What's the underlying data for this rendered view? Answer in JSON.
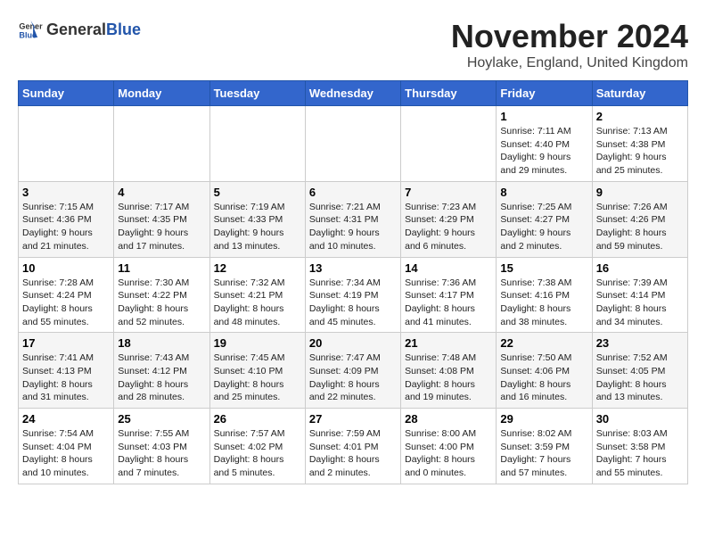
{
  "logo": {
    "general": "General",
    "blue": "Blue"
  },
  "title": "November 2024",
  "subtitle": "Hoylake, England, United Kingdom",
  "headers": [
    "Sunday",
    "Monday",
    "Tuesday",
    "Wednesday",
    "Thursday",
    "Friday",
    "Saturday"
  ],
  "weeks": [
    [
      {
        "day": "",
        "info": ""
      },
      {
        "day": "",
        "info": ""
      },
      {
        "day": "",
        "info": ""
      },
      {
        "day": "",
        "info": ""
      },
      {
        "day": "",
        "info": ""
      },
      {
        "day": "1",
        "info": "Sunrise: 7:11 AM\nSunset: 4:40 PM\nDaylight: 9 hours\nand 29 minutes."
      },
      {
        "day": "2",
        "info": "Sunrise: 7:13 AM\nSunset: 4:38 PM\nDaylight: 9 hours\nand 25 minutes."
      }
    ],
    [
      {
        "day": "3",
        "info": "Sunrise: 7:15 AM\nSunset: 4:36 PM\nDaylight: 9 hours\nand 21 minutes."
      },
      {
        "day": "4",
        "info": "Sunrise: 7:17 AM\nSunset: 4:35 PM\nDaylight: 9 hours\nand 17 minutes."
      },
      {
        "day": "5",
        "info": "Sunrise: 7:19 AM\nSunset: 4:33 PM\nDaylight: 9 hours\nand 13 minutes."
      },
      {
        "day": "6",
        "info": "Sunrise: 7:21 AM\nSunset: 4:31 PM\nDaylight: 9 hours\nand 10 minutes."
      },
      {
        "day": "7",
        "info": "Sunrise: 7:23 AM\nSunset: 4:29 PM\nDaylight: 9 hours\nand 6 minutes."
      },
      {
        "day": "8",
        "info": "Sunrise: 7:25 AM\nSunset: 4:27 PM\nDaylight: 9 hours\nand 2 minutes."
      },
      {
        "day": "9",
        "info": "Sunrise: 7:26 AM\nSunset: 4:26 PM\nDaylight: 8 hours\nand 59 minutes."
      }
    ],
    [
      {
        "day": "10",
        "info": "Sunrise: 7:28 AM\nSunset: 4:24 PM\nDaylight: 8 hours\nand 55 minutes."
      },
      {
        "day": "11",
        "info": "Sunrise: 7:30 AM\nSunset: 4:22 PM\nDaylight: 8 hours\nand 52 minutes."
      },
      {
        "day": "12",
        "info": "Sunrise: 7:32 AM\nSunset: 4:21 PM\nDaylight: 8 hours\nand 48 minutes."
      },
      {
        "day": "13",
        "info": "Sunrise: 7:34 AM\nSunset: 4:19 PM\nDaylight: 8 hours\nand 45 minutes."
      },
      {
        "day": "14",
        "info": "Sunrise: 7:36 AM\nSunset: 4:17 PM\nDaylight: 8 hours\nand 41 minutes."
      },
      {
        "day": "15",
        "info": "Sunrise: 7:38 AM\nSunset: 4:16 PM\nDaylight: 8 hours\nand 38 minutes."
      },
      {
        "day": "16",
        "info": "Sunrise: 7:39 AM\nSunset: 4:14 PM\nDaylight: 8 hours\nand 34 minutes."
      }
    ],
    [
      {
        "day": "17",
        "info": "Sunrise: 7:41 AM\nSunset: 4:13 PM\nDaylight: 8 hours\nand 31 minutes."
      },
      {
        "day": "18",
        "info": "Sunrise: 7:43 AM\nSunset: 4:12 PM\nDaylight: 8 hours\nand 28 minutes."
      },
      {
        "day": "19",
        "info": "Sunrise: 7:45 AM\nSunset: 4:10 PM\nDaylight: 8 hours\nand 25 minutes."
      },
      {
        "day": "20",
        "info": "Sunrise: 7:47 AM\nSunset: 4:09 PM\nDaylight: 8 hours\nand 22 minutes."
      },
      {
        "day": "21",
        "info": "Sunrise: 7:48 AM\nSunset: 4:08 PM\nDaylight: 8 hours\nand 19 minutes."
      },
      {
        "day": "22",
        "info": "Sunrise: 7:50 AM\nSunset: 4:06 PM\nDaylight: 8 hours\nand 16 minutes."
      },
      {
        "day": "23",
        "info": "Sunrise: 7:52 AM\nSunset: 4:05 PM\nDaylight: 8 hours\nand 13 minutes."
      }
    ],
    [
      {
        "day": "24",
        "info": "Sunrise: 7:54 AM\nSunset: 4:04 PM\nDaylight: 8 hours\nand 10 minutes."
      },
      {
        "day": "25",
        "info": "Sunrise: 7:55 AM\nSunset: 4:03 PM\nDaylight: 8 hours\nand 7 minutes."
      },
      {
        "day": "26",
        "info": "Sunrise: 7:57 AM\nSunset: 4:02 PM\nDaylight: 8 hours\nand 5 minutes."
      },
      {
        "day": "27",
        "info": "Sunrise: 7:59 AM\nSunset: 4:01 PM\nDaylight: 8 hours\nand 2 minutes."
      },
      {
        "day": "28",
        "info": "Sunrise: 8:00 AM\nSunset: 4:00 PM\nDaylight: 8 hours\nand 0 minutes."
      },
      {
        "day": "29",
        "info": "Sunrise: 8:02 AM\nSunset: 3:59 PM\nDaylight: 7 hours\nand 57 minutes."
      },
      {
        "day": "30",
        "info": "Sunrise: 8:03 AM\nSunset: 3:58 PM\nDaylight: 7 hours\nand 55 minutes."
      }
    ]
  ]
}
